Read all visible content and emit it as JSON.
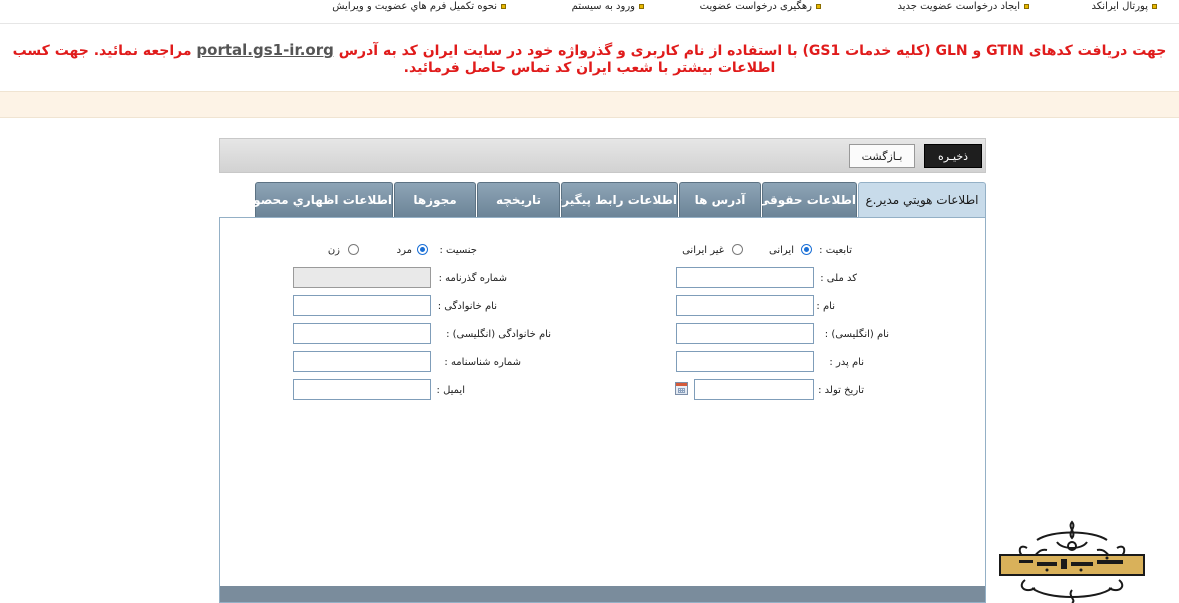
{
  "topnav": {
    "items": [
      {
        "label": "پورتال ایرانکد"
      },
      {
        "label": "ایجاد درخواست عضویت جدید"
      },
      {
        "label": "رهگیری درخواست عضویت"
      },
      {
        "label": "ورود به سیستم"
      },
      {
        "label": "نحوه تکمیل فرم هاي عضويت و ويرايش"
      }
    ]
  },
  "notice": {
    "line1_before": "جهت دریافت کدهای GTIN و GLN (کلیه خدمات GS1) با استفاده از نام کاربری و گذرواژه خود در سایت ایران کد به آدرس ",
    "link": "portal.gs1-ir.org",
    "line1_after": " مراجعه نمائید. جهت کسب",
    "line2": "اطلاعات بیشتر با شعب ایران کد تماس حاصل فرمائید."
  },
  "toolbar": {
    "save_label": "ذخیـره",
    "back_label": "بـازگشت"
  },
  "tabs": [
    {
      "label": "اطلاعات هويتي مدير.ع",
      "active": true
    },
    {
      "label": "اطلاعات حقوقی"
    },
    {
      "label": "آدرس ها"
    },
    {
      "label": "اطلاعات رابط پیگیری"
    },
    {
      "label": "تاریخچه"
    },
    {
      "label": "مجوزها"
    },
    {
      "label": "اطلاعات اظهاري محصول"
    }
  ],
  "form": {
    "nationality_label": "تابعیت :",
    "nationality_iranian": "ایرانی",
    "nationality_foreign": "غیر ایرانی",
    "gender_label": "جنسیت :",
    "gender_male": "مرد",
    "gender_female": "زن",
    "national_code_label": "کد ملی :",
    "passport_label": "شماره گذرنامه :",
    "first_name_label": "نام :",
    "last_name_label": "نام خانوادگی :",
    "first_name_en_label": "نام (انگلیسی) :",
    "last_name_en_label": "نام خانوادگی (انگلیسی) :",
    "father_name_label": "نام پدر :",
    "id_number_label": "شماره شناسنامه :",
    "birth_date_label": "تاریخ تولد :",
    "email_label": "ایمیل :",
    "nationality_selected": "ایرانی",
    "gender_selected": "مرد"
  },
  "colors": {
    "notice_red": "#e01b1b",
    "tab_blue": "#6c8497",
    "active_tab": "#c8dbea"
  }
}
